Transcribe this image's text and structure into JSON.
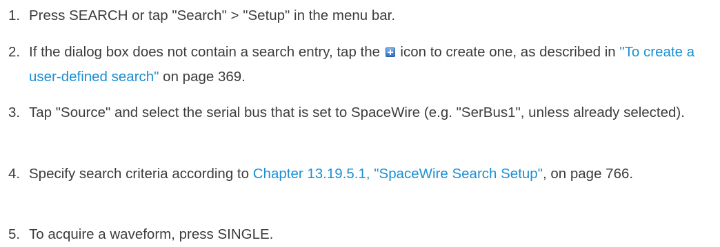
{
  "steps": [
    {
      "number": "1.",
      "text": "Press SEARCH or tap \"Search\" > \"Setup\" in the menu bar."
    },
    {
      "number": "2.",
      "text_before_icon": "If the dialog box does not contain a search entry, tap the ",
      "icon": "add-plus-icon",
      "text_after_icon": " icon to create one, as described in ",
      "link": "\"To create a user-defined search\"",
      "text_after_link": " on page 369."
    },
    {
      "number": "3.",
      "text": "Tap \"Source\" and select the serial bus that is set to SpaceWire (e.g. \"SerBus1\", unless already selected)."
    },
    {
      "number": "4.",
      "text_before_link": "Specify search criteria according to ",
      "link": "Chapter 13.19.5.1, \"SpaceWire Search Setup\"",
      "text_after_link": ", on page 766."
    },
    {
      "number": "5.",
      "text": "To acquire a waveform, press SINGLE."
    }
  ],
  "colors": {
    "text": "#3c3c3c",
    "link": "#1a8fd3",
    "icon": "#2f6fc9"
  }
}
